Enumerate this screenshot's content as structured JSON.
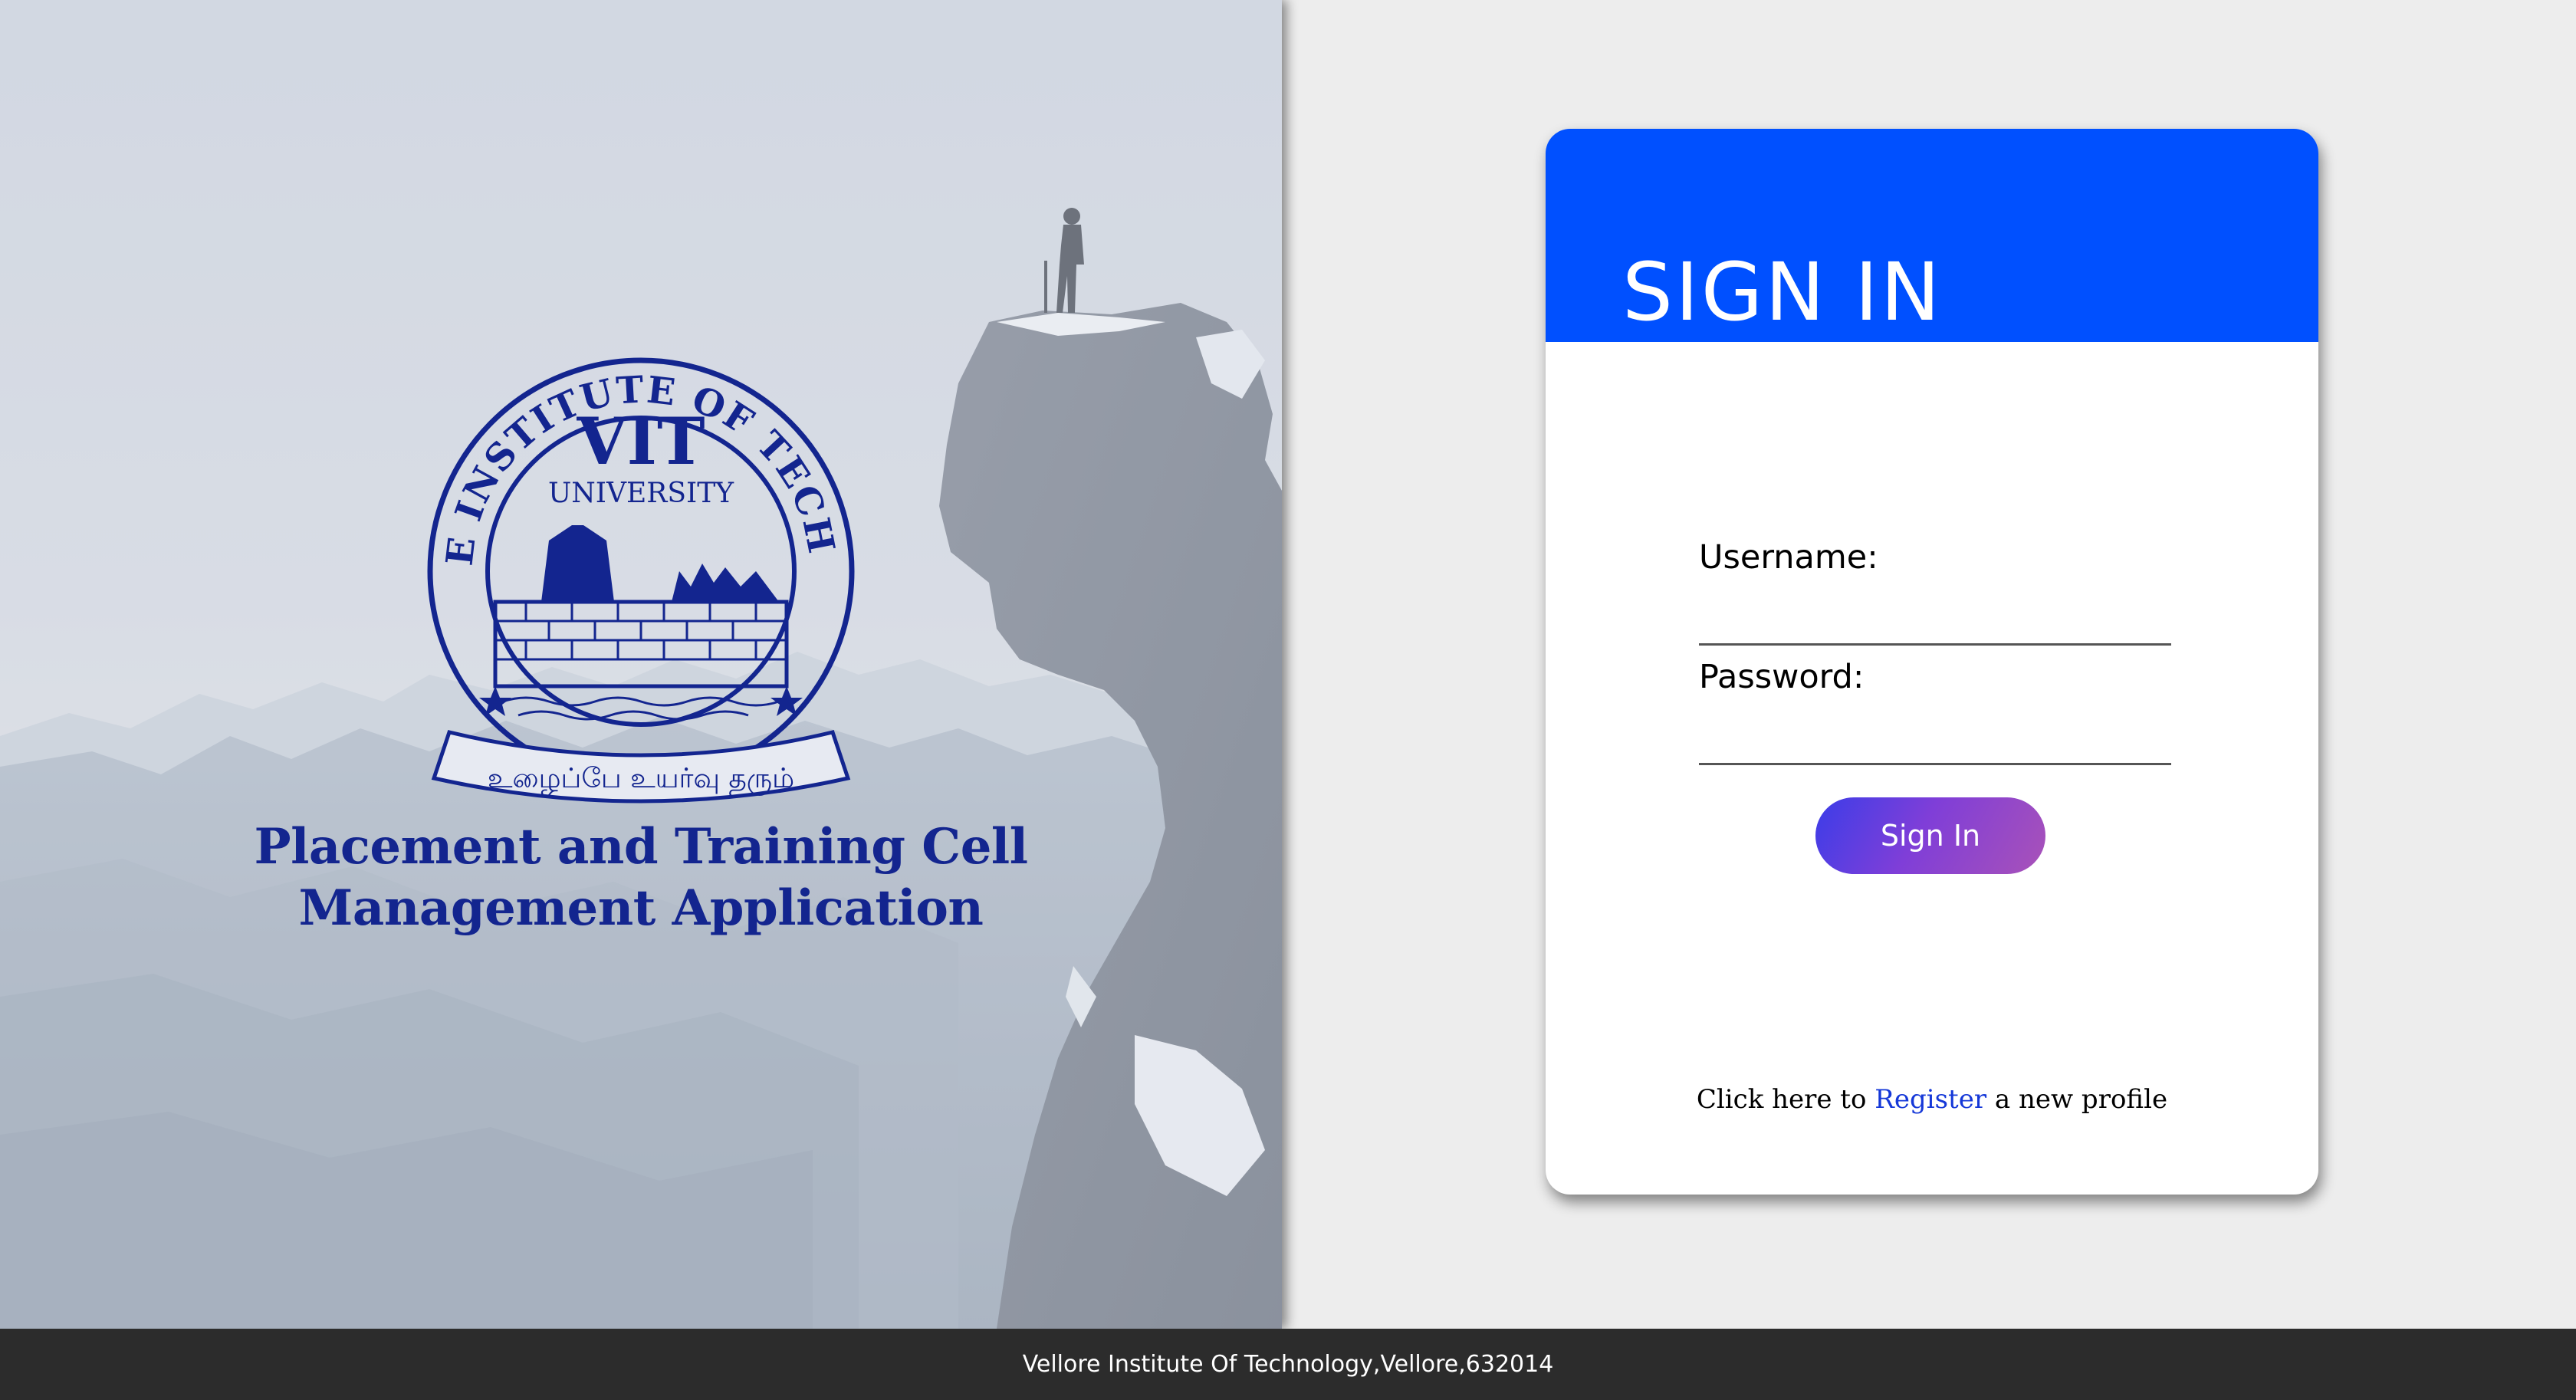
{
  "brand": {
    "seal": {
      "ring_text": "VELLORE INSTITUTE OF TECHNOLOGY",
      "name": "VIT",
      "subname": "UNIVERSITY",
      "motto": "உழைப்பே உயர்வு தரும்"
    },
    "title_line1": "Placement and Training Cell",
    "title_line2": "Management Application"
  },
  "signin": {
    "title": "SIGN IN",
    "username_label": "Username:",
    "username_value": "",
    "password_label": "Password:",
    "password_value": "",
    "button_label": "Sign In",
    "register_prefix": "Click here to ",
    "register_link": "Register",
    "register_suffix": " a new profile"
  },
  "footer": {
    "text": "Vellore Institute Of Technology,Vellore,632014"
  },
  "colors": {
    "header_blue": "#0050ff",
    "brand_navy": "#13258f",
    "button_gradient_start": "#3b3de8",
    "button_gradient_end": "#a952b8",
    "link_blue": "#1538d8",
    "footer_bg": "#2c2c2c",
    "page_bg": "#ededed"
  }
}
